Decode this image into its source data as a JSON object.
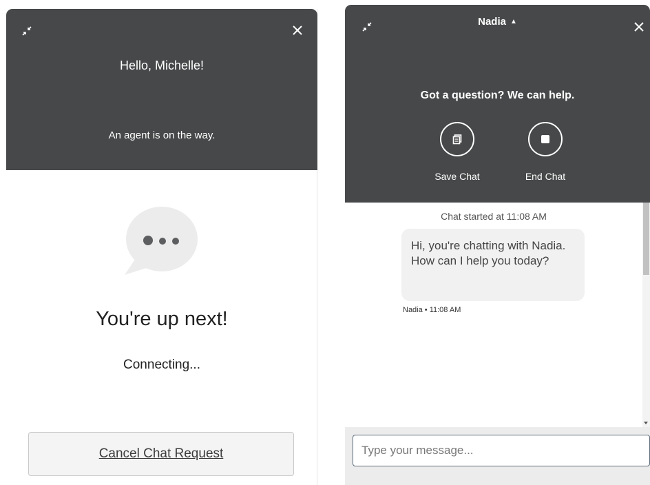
{
  "waiting_panel": {
    "greeting": "Hello, Michelle!",
    "status": "An agent is on the way.",
    "queue_title": "You're up next!",
    "queue_subtitle": "Connecting...",
    "cancel_label": "Cancel Chat Request",
    "icons": {
      "minimize": "minimize-icon",
      "close": "close-icon",
      "typing": "typing-bubble-icon"
    }
  },
  "chat_panel": {
    "agent_name": "Nadia",
    "agent_caret": "▲",
    "help_text": "Got a question? We can help.",
    "actions": [
      {
        "label": "Save Chat",
        "icon": "save-chat-icon"
      },
      {
        "label": "End Chat",
        "icon": "end-chat-icon"
      }
    ],
    "chat_started": "Chat started at 11:08 AM",
    "messages": [
      {
        "text": "Hi, you're chatting with Nadia. How can I help you today?",
        "meta": "Nadia • 11:08 AM"
      }
    ],
    "composer_placeholder": "Type your message..."
  },
  "colors": {
    "header_bg": "#464849",
    "bubble_bg": "#f1f1f1",
    "button_bg": "#f4f4f4",
    "composer_bg": "#ececec"
  }
}
